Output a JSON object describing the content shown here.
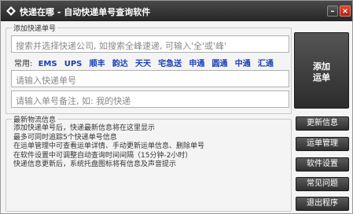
{
  "window": {
    "title": "快递在哪 - 自动快递单号查询软件",
    "icon": "diamond-app-icon",
    "minimize_label": "–",
    "close_label": "×"
  },
  "add_section": {
    "group_title": "添加快递单号",
    "company_placeholder": "搜索并选择快递公司, 如搜索全峰速递, 可输入'全'或'峰'",
    "common_label": "常用:",
    "common_couriers": [
      "EMS",
      "UPS",
      "顺丰",
      "韵达",
      "天天",
      "宅急送",
      "申通",
      "圆通",
      "中通",
      "汇通"
    ],
    "number_placeholder": "请输入快递单号",
    "note_placeholder": "请输入单号备注, 如: 我的快递",
    "add_button_line1": "添加",
    "add_button_line2": "运单"
  },
  "info_section": {
    "group_title": "最新物流信息",
    "lines": [
      "添加快递单号后，快递最新信息将在这里显示",
      "最多可同时追踪5个快递单号信息",
      "在运单管理中可查看运单详情、手动更新运单信息、删除单号",
      "在软件设置中可调整自动查询时间间隔（15分钟-2小时）",
      "快递信息更新后，系统托盘图标将有信息及声音提示"
    ]
  },
  "side_buttons": {
    "refresh": "更新信息",
    "manage": "运单管理",
    "settings": "软件设置",
    "faq": "常见问题",
    "exit": "退出程序"
  },
  "colors": {
    "titlebar": "#2f2f2f",
    "courier_link": "#1a3fb8",
    "close_button": "#c8301c",
    "dark_button": "#3a3a3a"
  }
}
